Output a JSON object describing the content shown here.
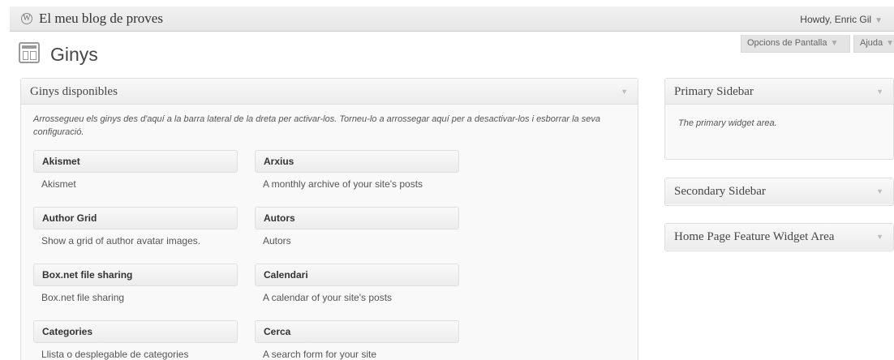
{
  "adminbar": {
    "site_name": "El meu blog de proves",
    "howdy": "Howdy, Enric Gil",
    "logo_glyph": "W"
  },
  "tabs": {
    "screen_options": "Opcions de Pantalla",
    "help": "Ajuda"
  },
  "page": {
    "title": "Ginys",
    "icon": "widgets-icon"
  },
  "available": {
    "title": "Ginys disponibles",
    "description": "Arrossegueu els ginys des d'aquí a la barra lateral de la dreta per activar-los. Torneu-lo a arrossegar aquí per a desactivar-los i esborrar la seva configuració.",
    "widgets": [
      {
        "title": "Akismet",
        "desc": "Akismet"
      },
      {
        "title": "Arxius",
        "desc": "A monthly archive of your site's posts"
      },
      {
        "title": "Author Grid",
        "desc": "Show a grid of author avatar images."
      },
      {
        "title": "Autors",
        "desc": "Autors"
      },
      {
        "title": "Box.net file sharing",
        "desc": "Box.net file sharing"
      },
      {
        "title": "Calendari",
        "desc": "A calendar of your site's posts"
      },
      {
        "title": "Categories",
        "desc": "Llista o desplegable de categories"
      },
      {
        "title": "Cerca",
        "desc": "A search form for your site"
      }
    ]
  },
  "sidebars": {
    "primary": {
      "title": "Primary Sidebar",
      "desc": "The primary widget area."
    },
    "secondary": {
      "title": "Secondary Sidebar"
    },
    "home": {
      "title": "Home Page Feature Widget Area"
    }
  },
  "glyphs": {
    "caret": "▼"
  }
}
